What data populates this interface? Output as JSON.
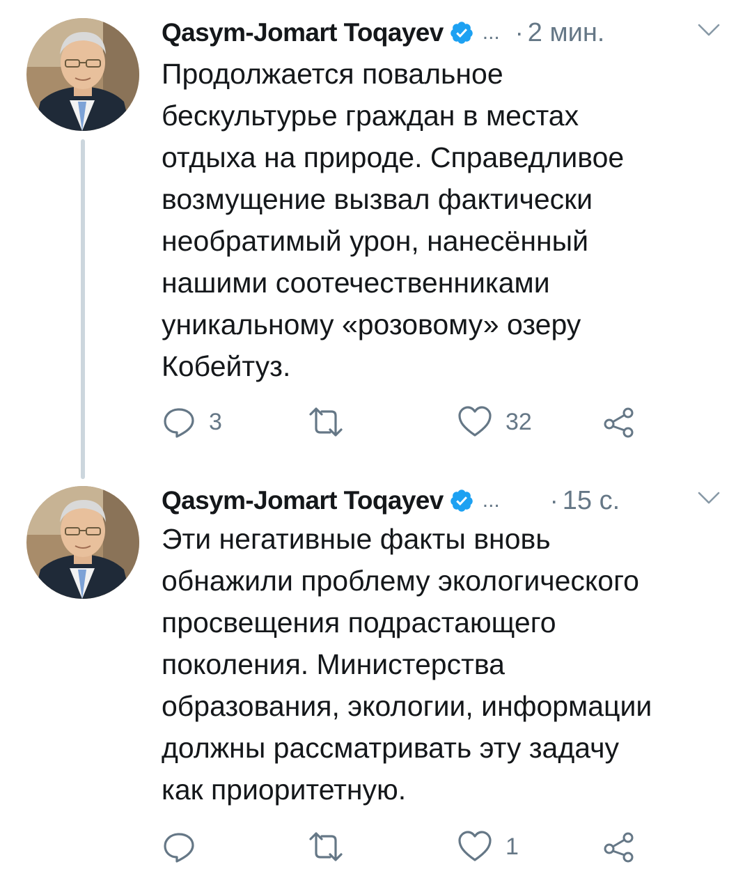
{
  "tweets": [
    {
      "author": "Qasym-Jomart Toqayev",
      "handle": "...",
      "separator": "·",
      "time": "2 мин.",
      "avatar_icon": "profile-photo",
      "text_lines": [
        "Продолжается повальное",
        "бескультурье граждан в местах",
        "отдыха на природе. Справедливое",
        "возмущение вызвал фактически",
        "необратимый урон, нанесённый",
        "нашими соотечественниками",
        "уникальному «розовому» озеру",
        "Кобейтуз."
      ],
      "replies": "3",
      "retweets": "",
      "likes": "32"
    },
    {
      "author": "Qasym-Jomart Toqayev",
      "handle": "...",
      "separator": "·",
      "time": "15 с.",
      "avatar_icon": "profile-photo",
      "text_lines": [
        "Эти негативные факты вновь",
        "обнажили проблему экологического",
        "просвещения подрастающего",
        "поколения. Министерства",
        "образования, экологии, информации",
        "должны рассматривать эту задачу",
        "как приоритетную."
      ],
      "replies": "",
      "retweets": "",
      "likes": "1"
    }
  ],
  "colors": {
    "text": "#14171a",
    "muted": "#657786",
    "verified": "#1da1f2",
    "thread_line": "#ccd6dd"
  },
  "icons": [
    "verified-badge-icon",
    "chevron-down-icon",
    "reply-icon",
    "retweet-icon",
    "like-icon",
    "share-icon"
  ]
}
